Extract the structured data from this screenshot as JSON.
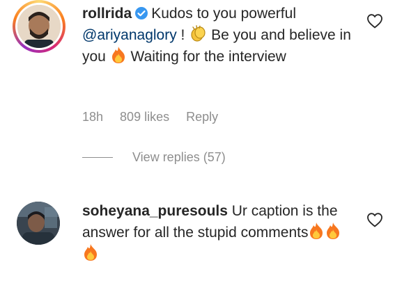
{
  "comments": [
    {
      "username": "rollrida",
      "verified": true,
      "text_part_1": "Kudos to you powerful ",
      "mention": "@ariyanaglory",
      "text_part_2": " ! ",
      "emoji_1": "clapping-hands-emoji",
      "text_part_3": " Be you and believe in you ",
      "emoji_2": "fire-emoji",
      "text_part_4": " Waiting for the interview",
      "time": "18h",
      "likes": "809 likes",
      "reply_label": "Reply",
      "view_replies": "View replies (57)"
    },
    {
      "username": "soheyana_puresouls",
      "text": " Ur caption is the answer for all the stupid comments",
      "emojis": [
        "fire-emoji",
        "fire-emoji",
        "fire-emoji"
      ]
    }
  ],
  "colors": {
    "text": "#262626",
    "muted": "#8e8e8e",
    "mention": "#00376b",
    "verified_badge": "#3897f0"
  }
}
